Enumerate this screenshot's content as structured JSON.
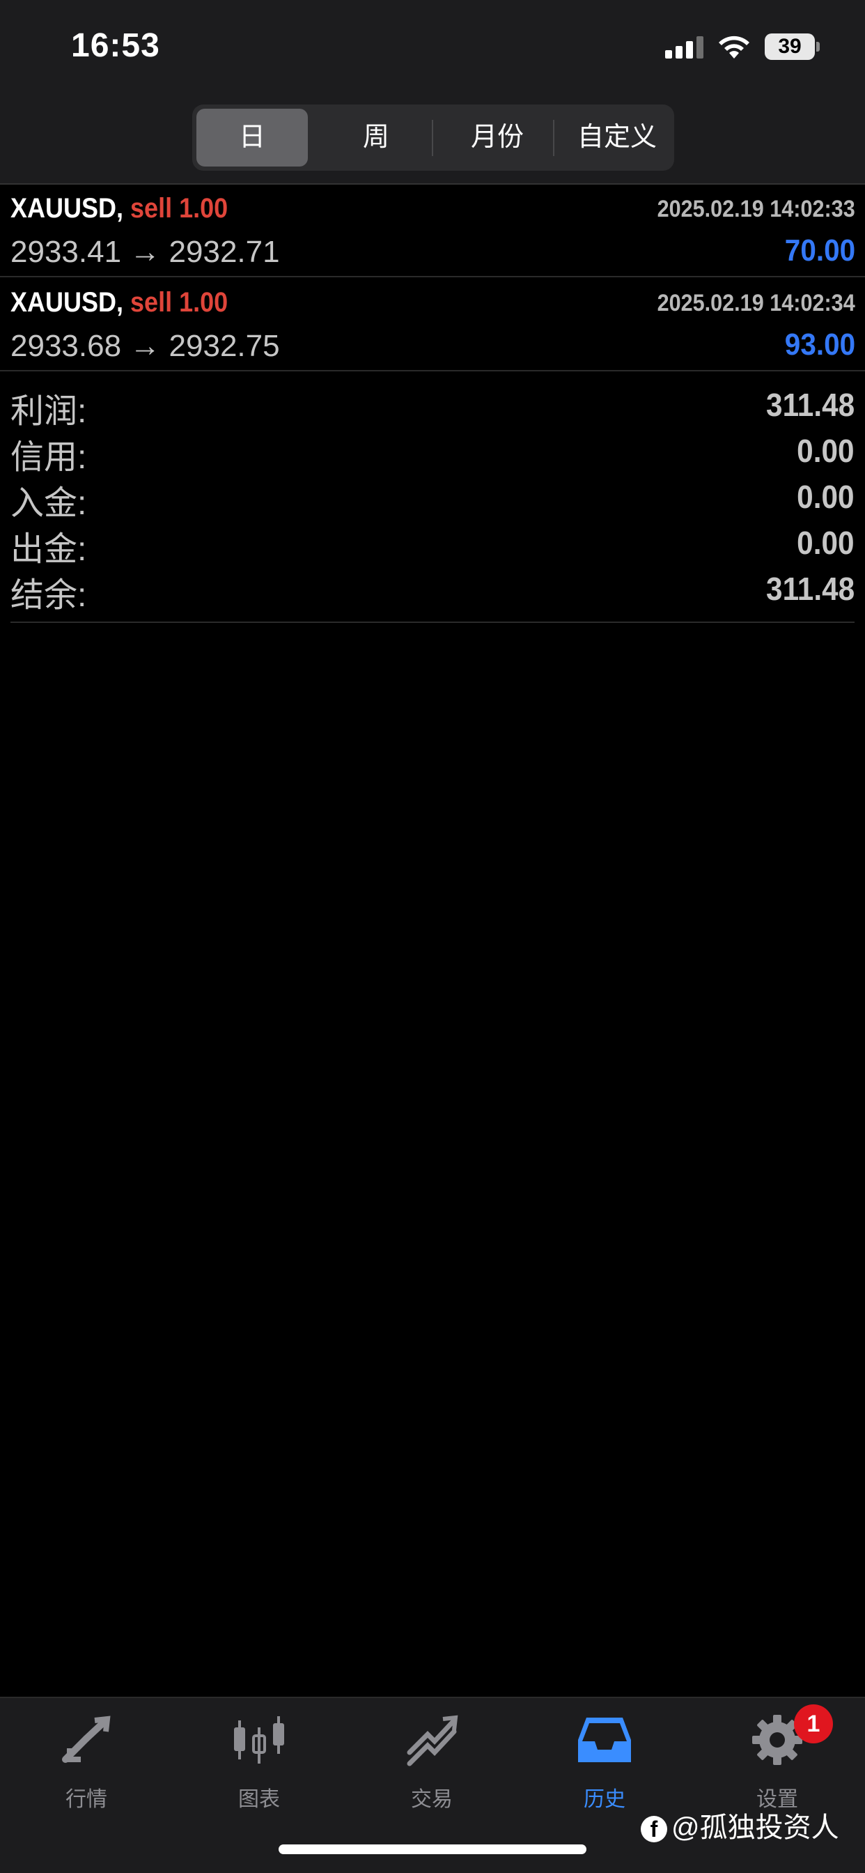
{
  "status_bar": {
    "time": "16:53",
    "battery": "39"
  },
  "periods": {
    "tabs": [
      "日",
      "周",
      "月份",
      "自定义"
    ],
    "selected": "日"
  },
  "trades": [
    {
      "symbol": "XAUUSD,",
      "side": "sell",
      "volume": "1.00",
      "open_price": "2933.41",
      "arrow": "→",
      "close_price": "2932.71",
      "datetime": "2025.02.19 14:02:33",
      "profit": "70.00"
    },
    {
      "symbol": "XAUUSD,",
      "side": "sell",
      "volume": "1.00",
      "open_price": "2933.68",
      "arrow": "→",
      "close_price": "2932.75",
      "datetime": "2025.02.19 14:02:34",
      "profit": "93.00"
    }
  ],
  "summary": [
    {
      "label": "利润:",
      "value": "311.48"
    },
    {
      "label": "信用:",
      "value": "0.00"
    },
    {
      "label": "入金:",
      "value": "0.00"
    },
    {
      "label": "出金:",
      "value": "0.00"
    },
    {
      "label": "结余:",
      "value": "311.48"
    }
  ],
  "tab_bar": [
    {
      "label": "行情",
      "icon": "quotes-icon"
    },
    {
      "label": "图表",
      "icon": "chart-icon"
    },
    {
      "label": "交易",
      "icon": "trade-icon"
    },
    {
      "label": "历史",
      "icon": "history-icon",
      "active": true
    },
    {
      "label": "设置",
      "icon": "settings-icon",
      "badge": "1"
    }
  ],
  "watermark": "@孤独投资人",
  "colors": {
    "sell": "#e0453a",
    "profit": "#3478f6",
    "active_tab": "#3a8dff",
    "badge": "#e0161f"
  }
}
